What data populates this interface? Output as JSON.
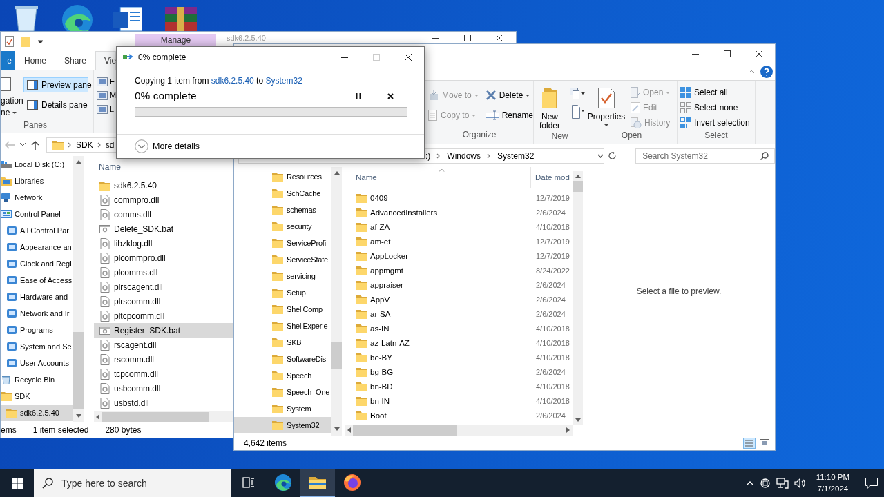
{
  "back_window": {
    "context_tab": "Manage",
    "title": "sdk6.2.5.40",
    "tabs": [
      {
        "label": "e",
        "kind": "file",
        "selected": false
      },
      {
        "label": "Home",
        "kind": "tab",
        "selected": false
      },
      {
        "label": "Share",
        "kind": "tab",
        "selected": false
      },
      {
        "label": "Vie",
        "kind": "tab",
        "selected": true
      }
    ],
    "ribbon": {
      "navigation_pane": [
        "gation",
        "ne"
      ],
      "panes": [
        {
          "label": "Preview pane",
          "selected": true
        },
        {
          "label": "Details pane",
          "selected": false
        }
      ],
      "group_label": "Panes",
      "layouts": [
        "E",
        "M",
        "L"
      ]
    },
    "address": [
      "SDK",
      "sd"
    ],
    "nav": [
      {
        "label": "Local Disk (C:)",
        "kind": "drive",
        "selected": false
      },
      {
        "label": "Libraries",
        "kind": "library",
        "selected": false
      },
      {
        "label": "Network",
        "kind": "network",
        "selected": false
      },
      {
        "label": "Control Panel",
        "kind": "control-panel",
        "selected": false,
        "children": [
          {
            "label": "All Control Par",
            "kind": "applet",
            "selected": false
          },
          {
            "label": "Appearance an",
            "kind": "applet",
            "selected": false
          },
          {
            "label": "Clock and Regi",
            "kind": "applet",
            "selected": false
          },
          {
            "label": "Ease of Access",
            "kind": "applet",
            "selected": false
          },
          {
            "label": "Hardware and",
            "kind": "applet",
            "selected": false
          },
          {
            "label": "Network and Ir",
            "kind": "applet",
            "selected": false
          },
          {
            "label": "Programs",
            "kind": "applet",
            "selected": false
          },
          {
            "label": "System and Se",
            "kind": "applet",
            "selected": false
          },
          {
            "label": "User Accounts",
            "kind": "applet",
            "selected": false
          }
        ]
      },
      {
        "label": "Recycle Bin",
        "kind": "recycle-bin",
        "selected": false
      },
      {
        "label": "SDK",
        "kind": "folder",
        "selected": false,
        "children": [
          {
            "label": "sdk6.2.5.40",
            "kind": "folder",
            "selected": true
          }
        ]
      }
    ],
    "column": "Name",
    "files": [
      {
        "name": "sdk6.2.5.40",
        "kind": "folder",
        "selected": false
      },
      {
        "name": "commpro.dll",
        "kind": "dll",
        "selected": false
      },
      {
        "name": "comms.dll",
        "kind": "dll",
        "selected": false
      },
      {
        "name": "Delete_SDK.bat",
        "kind": "bat",
        "selected": false
      },
      {
        "name": "libzklog.dll",
        "kind": "dll",
        "selected": false
      },
      {
        "name": "plcommpro.dll",
        "kind": "dll",
        "selected": false
      },
      {
        "name": "plcomms.dll",
        "kind": "dll",
        "selected": false
      },
      {
        "name": "plrscagent.dll",
        "kind": "dll",
        "selected": false
      },
      {
        "name": "plrscomm.dll",
        "kind": "dll",
        "selected": false
      },
      {
        "name": "pltcpcomm.dll",
        "kind": "dll",
        "selected": false
      },
      {
        "name": "Register_SDK.bat",
        "kind": "bat",
        "selected": true
      },
      {
        "name": "rscagent.dll",
        "kind": "dll",
        "selected": false
      },
      {
        "name": "rscomm.dll",
        "kind": "dll",
        "selected": false
      },
      {
        "name": "tcpcomm.dll",
        "kind": "dll",
        "selected": false
      },
      {
        "name": "usbcomm.dll",
        "kind": "dll",
        "selected": false
      },
      {
        "name": "usbstd.dll",
        "kind": "dll",
        "selected": false
      }
    ],
    "status": [
      "ems",
      "1 item selected",
      "280 bytes"
    ]
  },
  "front_window": {
    "ribbon": [
      {
        "label": "Organize",
        "kind": "organize",
        "items": [
          {
            "label": "Move to",
            "kind": "move",
            "disabled": true,
            "dropdown": true
          },
          {
            "label": "Copy to",
            "kind": "copy",
            "disabled": true,
            "dropdown": true
          },
          {
            "label": "Delete",
            "kind": "delete",
            "disabled": false,
            "dropdown": true
          },
          {
            "label": "Rename",
            "kind": "rename",
            "disabled": false,
            "dropdown": false
          }
        ]
      },
      {
        "label": "New",
        "kind": "new",
        "items": [
          {
            "label": "New folder",
            "kind": "new-folder",
            "disabled": false,
            "dropdown": false
          }
        ]
      },
      {
        "label": "Open",
        "kind": "open",
        "items": [
          {
            "label": "Properties",
            "kind": "properties",
            "disabled": false,
            "dropdown": true
          },
          {
            "label": "Open",
            "kind": "open",
            "disabled": true,
            "dropdown": true
          },
          {
            "label": "Edit",
            "kind": "edit",
            "disabled": true,
            "dropdown": false
          },
          {
            "label": "History",
            "kind": "history",
            "disabled": true,
            "dropdown": false
          }
        ]
      },
      {
        "label": "Select",
        "kind": "select",
        "items": [
          {
            "label": "Select all",
            "kind": "select-all",
            "disabled": false,
            "dropdown": false
          },
          {
            "label": "Select none",
            "kind": "select-none",
            "disabled": false,
            "dropdown": false
          },
          {
            "label": "Invert selection",
            "kind": "invert",
            "disabled": false,
            "dropdown": false
          }
        ]
      }
    ],
    "address": [
      ":)",
      "Windows",
      "System32"
    ],
    "search": {
      "placeholder": "Search System32"
    },
    "nav": [
      {
        "label": "Resources",
        "selected": false
      },
      {
        "label": "SchCache",
        "selected": false
      },
      {
        "label": "schemas",
        "selected": false
      },
      {
        "label": "security",
        "selected": false
      },
      {
        "label": "ServiceProfi",
        "selected": false
      },
      {
        "label": "ServiceState",
        "selected": false
      },
      {
        "label": "servicing",
        "selected": false
      },
      {
        "label": "Setup",
        "selected": false
      },
      {
        "label": "ShellComp",
        "selected": false
      },
      {
        "label": "ShellExperie",
        "selected": false
      },
      {
        "label": "SKB",
        "selected": false
      },
      {
        "label": "SoftwareDis",
        "selected": false
      },
      {
        "label": "Speech",
        "selected": false
      },
      {
        "label": "Speech_One",
        "selected": false
      },
      {
        "label": "System",
        "selected": false
      },
      {
        "label": "System32",
        "selected": true
      }
    ],
    "columns": [
      "Name",
      "Date mod"
    ],
    "rows": [
      {
        "name": "0409",
        "date": "12/7/2019"
      },
      {
        "name": "AdvancedInstallers",
        "date": "2/6/2024"
      },
      {
        "name": "af-ZA",
        "date": "4/10/2018"
      },
      {
        "name": "am-et",
        "date": "12/7/2019"
      },
      {
        "name": "AppLocker",
        "date": "12/7/2019"
      },
      {
        "name": "appmgmt",
        "date": "8/24/2022"
      },
      {
        "name": "appraiser",
        "date": "2/6/2024"
      },
      {
        "name": "AppV",
        "date": "2/6/2024"
      },
      {
        "name": "ar-SA",
        "date": "2/6/2024"
      },
      {
        "name": "as-IN",
        "date": "4/10/2018"
      },
      {
        "name": "az-Latn-AZ",
        "date": "4/10/2018"
      },
      {
        "name": "be-BY",
        "date": "4/10/2018"
      },
      {
        "name": "bg-BG",
        "date": "2/6/2024"
      },
      {
        "name": "bn-BD",
        "date": "4/10/2018"
      },
      {
        "name": "bn-IN",
        "date": "4/10/2018"
      },
      {
        "name": "Boot",
        "date": "2/6/2024"
      }
    ],
    "preview": "Select a file to preview.",
    "status": "4,642 items"
  },
  "copy_dialog": {
    "title": "0% complete",
    "message": {
      "prefix": "Copying 1 item from",
      "source": "sdk6.2.5.40",
      "joiner": "to",
      "destination": "System32"
    },
    "heading": "0% complete",
    "level": 0,
    "more_details": "More details"
  },
  "taskbar": {
    "search": {
      "placeholder": "Type here to search"
    },
    "apps": [
      {
        "kind": "task-view",
        "selected": false
      },
      {
        "kind": "edge",
        "selected": false
      },
      {
        "kind": "explorer",
        "selected": true
      },
      {
        "kind": "firefox",
        "selected": false
      }
    ],
    "time": "11:10 PM",
    "date": "7/1/2024"
  }
}
